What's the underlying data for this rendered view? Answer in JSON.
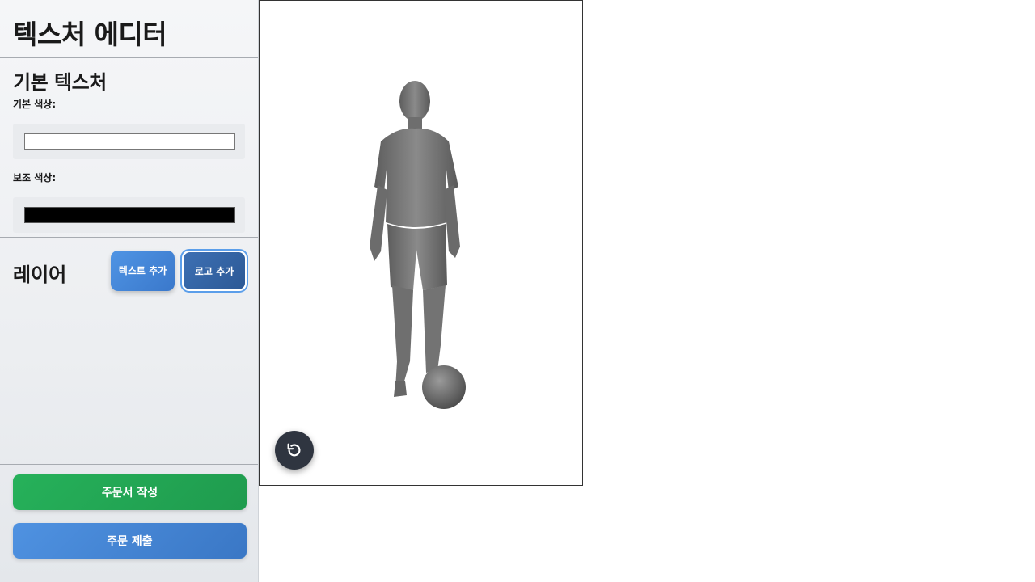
{
  "app": {
    "title": "텍스처 에디터"
  },
  "base_texture": {
    "title": "기본 텍스처",
    "primary_label": "기본 색상:",
    "primary_color": "#ffffff",
    "secondary_label": "보조 색상:",
    "secondary_color": "#000000"
  },
  "layers": {
    "title": "레이어",
    "add_text_label": "텍스트 추가",
    "add_logo_label": "로고 추가"
  },
  "actions": {
    "write_order_label": "주문서 작성",
    "submit_order_label": "주문 제출"
  },
  "viewport": {
    "model": "soccer-player-3d-model",
    "reset_icon": "rotate-reset-icon"
  },
  "colors": {
    "accent_blue": "#3a78cb",
    "success_green": "#22a855",
    "dark_button": "#2f3540"
  }
}
